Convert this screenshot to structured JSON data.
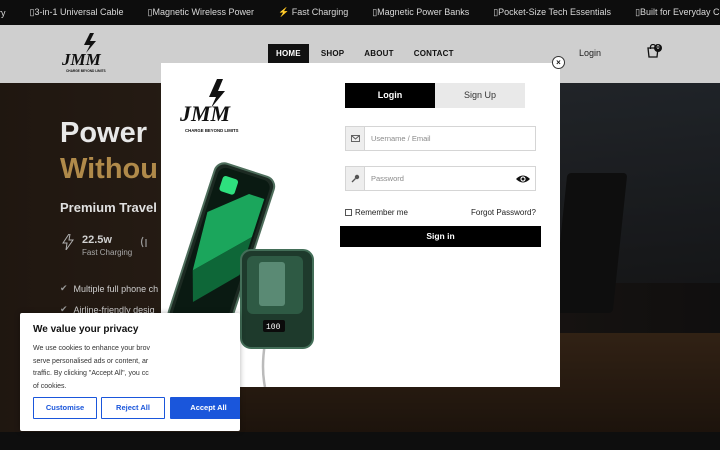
{
  "ticker": {
    "items": [
      "ry",
      "▯3-in-1 Universal Cable",
      "▯Magnetic Wireless Power",
      "⚡ Fast Charging",
      "▯Magnetic Power Banks",
      "▯Pocket-Size Tech Essentials",
      "▯Built for Everyday C"
    ]
  },
  "header": {
    "logo_text": "JMM",
    "logo_tagline": "CHARGE BEYOND LIMITS",
    "nav": [
      "HOME",
      "SHOP",
      "ABOUT",
      "CONTACT"
    ],
    "login": "Login",
    "cart_count": "0"
  },
  "hero": {
    "title_line1": "Power",
    "title_line2": "Withou",
    "subtitle": "Premium Travel",
    "stat_value": "22.5w",
    "stat_label": "Fast Charging",
    "features": [
      "Multiple full phone ch",
      "Airline-friendly desig"
    ]
  },
  "modal": {
    "logo_text": "JMM",
    "logo_tagline": "CHARGE BEYOND LIMITS",
    "close": "×",
    "tab_login": "Login",
    "tab_signup": "Sign Up",
    "username_placeholder": "Username / Email",
    "password_placeholder": "Password",
    "remember": "Remember me",
    "forgot": "Forgot Password?",
    "signin": "Sign in"
  },
  "cookie": {
    "title": "We value your privacy",
    "line1": "We use cookies to enhance your brov",
    "line2": "serve personalised ads or content, ar",
    "line3": "traffic. By clicking \"Accept All\", you cc",
    "line4": "of cookies.",
    "customise": "Customise",
    "reject": "Reject All",
    "accept": "Accept All"
  },
  "colors": {
    "accent": "#1a56db",
    "gold": "#b08a4a",
    "dark": "#000000"
  }
}
